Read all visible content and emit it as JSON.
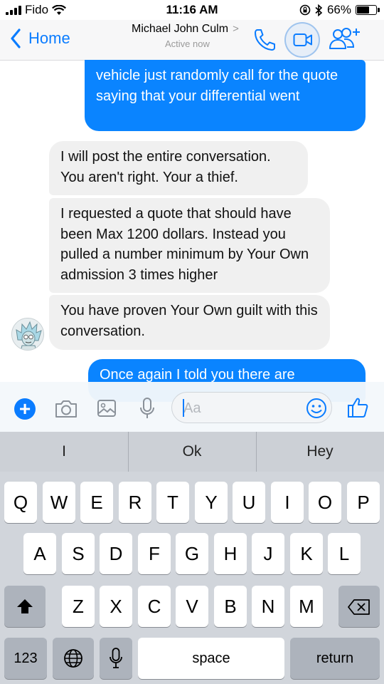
{
  "status_bar": {
    "carrier": "Fido",
    "time": "11:16 AM",
    "battery": "66%",
    "battery_level": 0.66
  },
  "nav": {
    "back_label": "Home",
    "contact_name": "Michael John Culm",
    "contact_status": "Active now",
    "icons": [
      "chevron-left-icon",
      "phone-icon",
      "video-icon",
      "add-people-icon"
    ]
  },
  "messages": [
    {
      "side": "out",
      "text": "vehicle just randomly call for the quote saying that your differential went"
    },
    {
      "side": "in",
      "text": "I will post the entire conversation. You aren't right. Your a thief."
    },
    {
      "side": "in",
      "text": "I requested a quote that should have been Max 1200 dollars. Instead you pulled a number minimum by Your Own admission 3 times higher"
    },
    {
      "side": "in",
      "text": "You have proven Your Own guilt with this conversation."
    },
    {
      "side": "out",
      "text": "Once again I told you there are"
    }
  ],
  "composer": {
    "placeholder": "Aa",
    "icons": [
      "plus-icon",
      "camera-icon",
      "image-icon",
      "mic-icon",
      "emoji-icon",
      "thumbs-up-icon"
    ]
  },
  "keyboard": {
    "suggestions": [
      "I",
      "Ok",
      "Hey"
    ],
    "row1": [
      "Q",
      "W",
      "E",
      "R",
      "T",
      "Y",
      "U",
      "I",
      "O",
      "P"
    ],
    "row2": [
      "A",
      "S",
      "D",
      "F",
      "G",
      "H",
      "J",
      "K",
      "L"
    ],
    "row3": [
      "Z",
      "X",
      "C",
      "V",
      "B",
      "N",
      "M"
    ],
    "numbers_key": "123",
    "space_key": "space",
    "return_key": "return"
  },
  "colors": {
    "accent": "#0a7cff",
    "outgoing_bubble": "#0a84ff",
    "incoming_bubble": "#f0f0f0",
    "keyboard_bg": "#d1d5db"
  }
}
